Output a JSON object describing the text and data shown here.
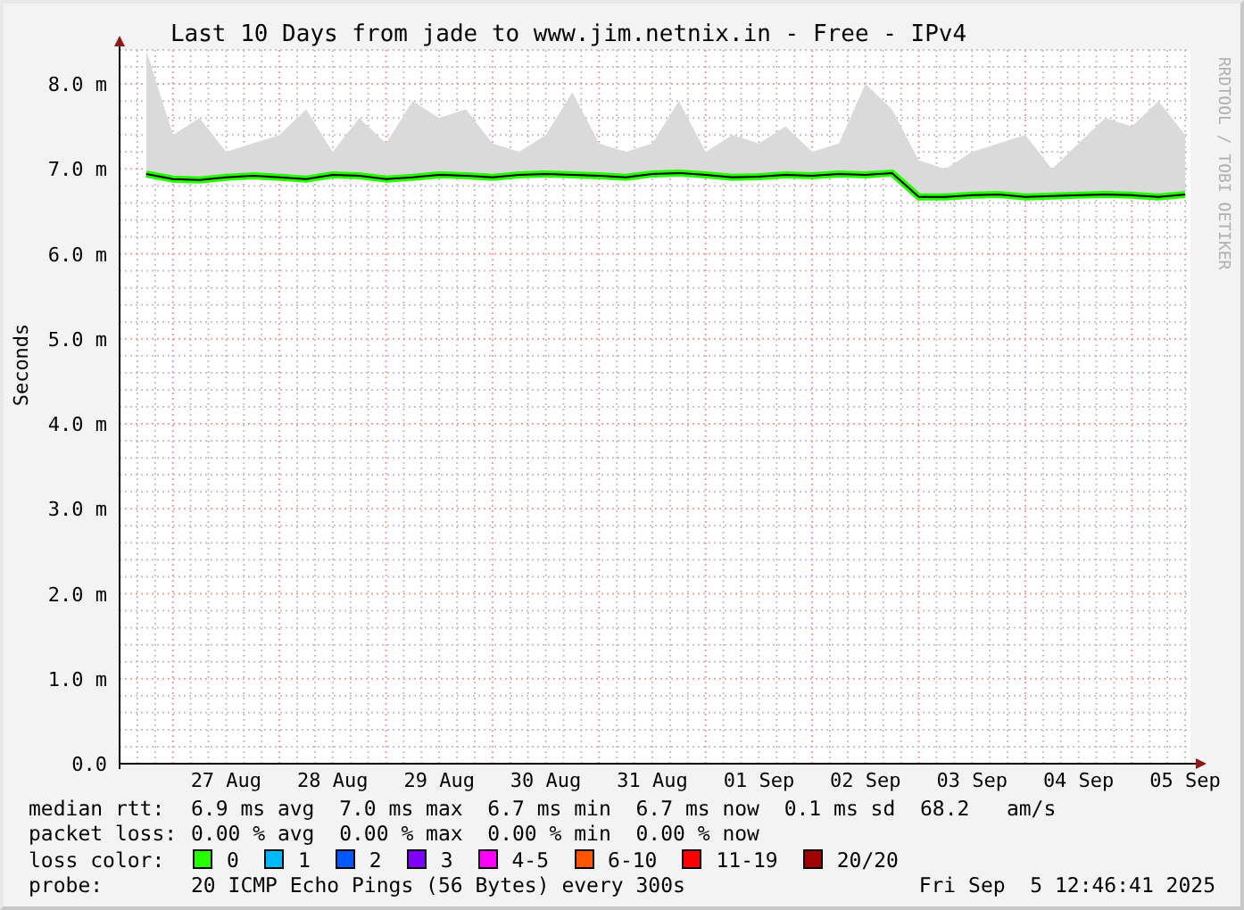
{
  "chart": {
    "chart_data": {
      "type": "line",
      "title": "Last 10 Days from jade to www.jim.netnix.in - Free - IPv4",
      "ylabel": "Seconds",
      "categories": [
        null,
        null,
        null,
        "27 Aug",
        null,
        null,
        null,
        "28 Aug",
        null,
        null,
        null,
        "29 Aug",
        null,
        null,
        null,
        "30 Aug",
        null,
        null,
        null,
        "31 Aug",
        null,
        null,
        null,
        "01 Sep",
        null,
        null,
        null,
        "02 Sep",
        null,
        null,
        null,
        "03 Sep",
        null,
        null,
        null,
        "04 Sep",
        null,
        null,
        null,
        "05 Sep"
      ],
      "series": [
        {
          "type": "area",
          "color": "#dadada",
          "values": [
            8.4,
            7.4,
            7.6,
            7.2,
            7.3,
            7.4,
            7.7,
            7.2,
            7.6,
            7.3,
            7.8,
            7.6,
            7.7,
            7.3,
            7.2,
            7.4,
            7.9,
            7.3,
            7.2,
            7.3,
            7.8,
            7.2,
            7.4,
            7.3,
            7.5,
            7.2,
            7.3,
            8.0,
            7.7,
            7.1,
            7.0,
            7.2,
            7.3,
            7.4,
            7.0,
            7.3,
            7.6,
            7.5,
            7.8,
            7.4
          ]
        },
        {
          "type": "line",
          "color": "#26ff00",
          "values": [
            6.94,
            6.88,
            6.87,
            6.9,
            6.92,
            6.9,
            6.88,
            6.93,
            6.92,
            6.88,
            6.9,
            6.93,
            6.92,
            6.9,
            6.93,
            6.94,
            6.93,
            6.92,
            6.9,
            6.94,
            6.95,
            6.93,
            6.9,
            6.91,
            6.93,
            6.92,
            6.94,
            6.93,
            6.95,
            6.67,
            6.67,
            6.69,
            6.7,
            6.67,
            6.68,
            6.69,
            6.7,
            6.69,
            6.67,
            6.7
          ]
        }
      ],
      "grid": true,
      "ylim": [
        0,
        8.4
      ],
      "yticks": [
        {
          "value": 0,
          "label": "0.0"
        },
        {
          "value": 1,
          "label": "1.0 m"
        },
        {
          "value": 2,
          "label": "2.0 m"
        },
        {
          "value": 3,
          "label": "3.0 m"
        },
        {
          "value": 4,
          "label": "4.0 m"
        },
        {
          "value": 5,
          "label": "5.0 m"
        },
        {
          "value": 6,
          "label": "6.0 m"
        },
        {
          "value": 7,
          "label": "7.0 m"
        },
        {
          "value": 8,
          "label": "8.0 m"
        }
      ]
    },
    "credit": "RRDTOOL / TOBI OETIKER"
  },
  "stats": [
    {
      "label": "median rtt:",
      "text": "6.9 ms avg  7.0 ms max  6.7 ms min  6.7 ms now  0.1 ms sd  68.2   am/s"
    },
    {
      "label": "packet loss:",
      "text": "0.00 % avg  0.00 % max  0.00 % min  0.00 % now"
    }
  ],
  "loss_colors": {
    "label": "loss color:",
    "items": [
      {
        "label": "0",
        "color": "#26ff00"
      },
      {
        "label": "1",
        "color": "#00b8ff"
      },
      {
        "label": "2",
        "color": "#0059ff"
      },
      {
        "label": "3",
        "color": "#7e00ff"
      },
      {
        "label": "4-5",
        "color": "#ff00ff"
      },
      {
        "label": "6-10",
        "color": "#ff5500"
      },
      {
        "label": "11-19",
        "color": "#ff0000"
      },
      {
        "label": "20/20",
        "color": "#a10000"
      }
    ]
  },
  "probe": {
    "label": "probe:",
    "text": "20 ICMP Echo Pings (56 Bytes) every 300s",
    "timestamp": "Fri Sep  5 12:46:41 2025"
  }
}
